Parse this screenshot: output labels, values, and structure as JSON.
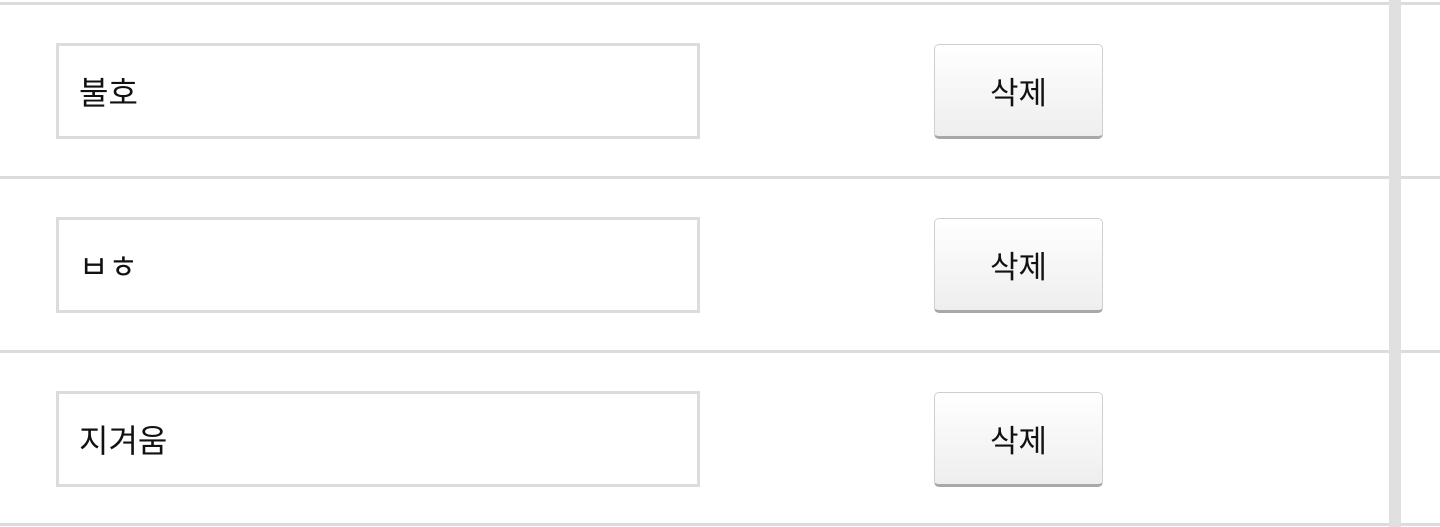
{
  "rows": [
    {
      "value": "불호",
      "delete_label": "삭제"
    },
    {
      "value": "ㅂㅎ",
      "delete_label": "삭제"
    },
    {
      "value": "지겨움",
      "delete_label": "삭제"
    }
  ]
}
